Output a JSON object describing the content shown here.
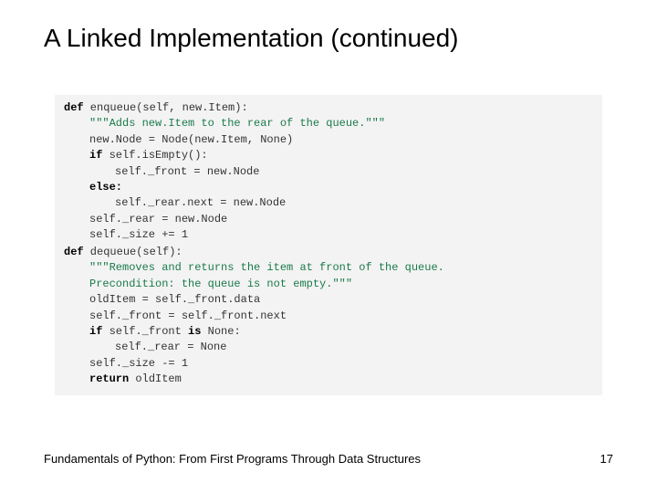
{
  "title": "A Linked Implementation (continued)",
  "footer": "Fundamentals of Python: From First Programs Through Data Structures",
  "page_number": "17",
  "code1": {
    "l1a": "def",
    "l1b": " enqueue(self, new.Item):",
    "l2": "\"\"\"Adds new.Item to the rear of the queue.\"\"\"",
    "l3": "new.Node = Node(new.Item, None)",
    "l4a": "if",
    "l4b": " self.isEmpty():",
    "l5": "self._front = new.Node",
    "l6": "else:",
    "l7": "self._rear.next = new.Node",
    "l8": "self._rear = new.Node",
    "l9": "self._size += 1"
  },
  "code2": {
    "l1a": "def",
    "l1b": "  dequeue(self):",
    "l2": "\"\"\"Removes and returns the item at front of the queue.",
    "l3": "Precondition: the queue is not empty.\"\"\"",
    "l4": "oldItem = self._front.data",
    "l5": "self._front = self._front.next",
    "l6a": "if",
    "l6b": " self._front ",
    "l6c": "is",
    "l6d": " None:",
    "l7": "self._rear = None",
    "l8": "self._size -= 1",
    "l9a": "return",
    "l9b": " oldItem"
  }
}
